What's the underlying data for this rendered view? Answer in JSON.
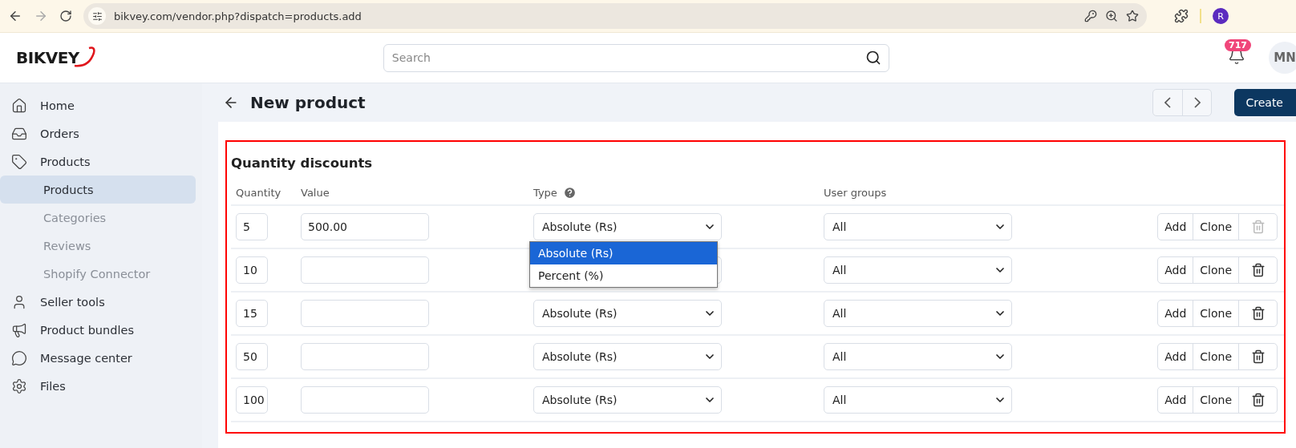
{
  "browser": {
    "url": "bikvey.com/vendor.php?dispatch=products.add",
    "profile": "R"
  },
  "header": {
    "logo": "BIKVEY",
    "search": {
      "placeholder": "Search"
    },
    "notifications": "717",
    "avatar": "MN"
  },
  "sidebar": {
    "items": [
      {
        "label": "Home",
        "selected": false
      },
      {
        "label": "Orders",
        "selected": false
      },
      {
        "label": "Products",
        "selected": false,
        "children": [
          {
            "label": "Products",
            "selected": true
          },
          {
            "label": "Categories",
            "selected": false
          },
          {
            "label": "Reviews",
            "selected": false
          },
          {
            "label": "Shopify Connector",
            "selected": false
          }
        ]
      },
      {
        "label": "Seller tools",
        "selected": false
      },
      {
        "label": "Product bundles",
        "selected": false
      },
      {
        "label": "Message center",
        "selected": false
      },
      {
        "label": "Files",
        "selected": false
      }
    ]
  },
  "page": {
    "title": "New product",
    "create_button": "Create"
  },
  "section": {
    "title": "Quantity discounts",
    "columns": [
      "Quantity",
      "Value",
      "Type",
      "User groups"
    ],
    "rows": [
      {
        "quantity": "5",
        "value": "500.00",
        "type": "Absolute (Rs)",
        "user_group": "All",
        "add": "Add",
        "clone": "Clone",
        "delete_disabled": true,
        "type_options": [
          {
            "label": "Absolute (Rs)",
            "selected": true
          },
          {
            "label": "Percent (%)",
            "selected": false
          }
        ]
      },
      {
        "quantity": "10",
        "user_group": "All",
        "add": "Add",
        "clone": "Clone",
        "delete_disabled": false
      },
      {
        "quantity": "15",
        "type": "Absolute (Rs)",
        "user_group": "All",
        "add": "Add",
        "clone": "Clone",
        "delete_disabled": false
      },
      {
        "quantity": "50",
        "type": "Absolute (Rs)",
        "user_group": "All",
        "add": "Add",
        "clone": "Clone",
        "delete_disabled": false
      },
      {
        "quantity": "100",
        "type": "Absolute (Rs)",
        "user_group": "All",
        "add": "Add",
        "clone": "Clone",
        "delete_disabled": false
      }
    ]
  }
}
